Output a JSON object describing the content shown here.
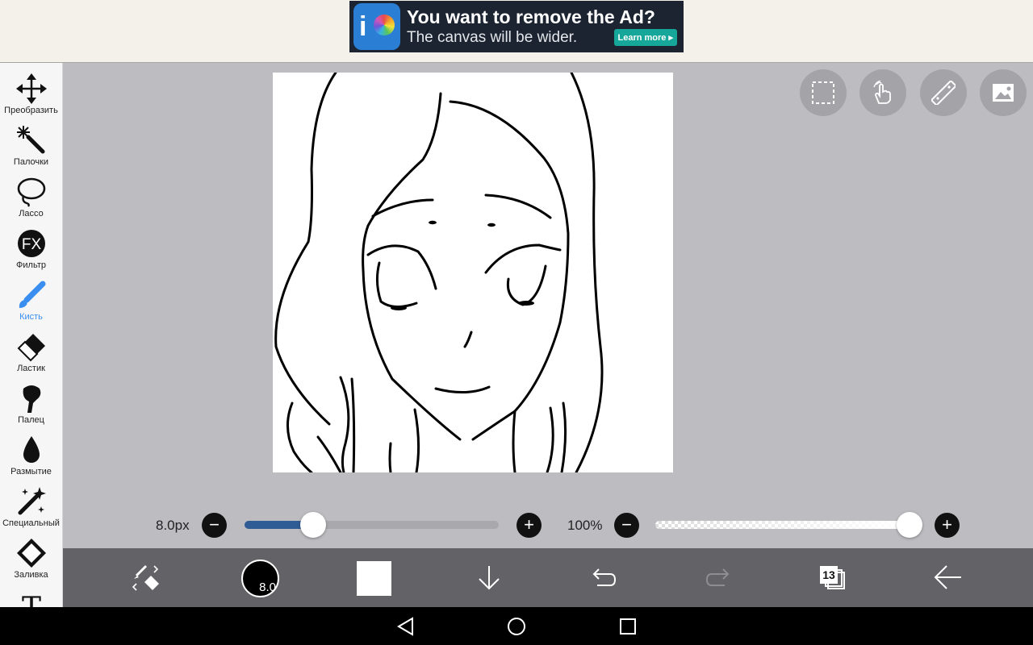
{
  "ad": {
    "headline": "You want to remove the Ad?",
    "subline": "The canvas will be wider.",
    "cta": "Learn more ▸"
  },
  "tools": [
    {
      "label": "Преобразить",
      "icon": "move-icon"
    },
    {
      "label": "Палочки",
      "icon": "magic-wand-icon"
    },
    {
      "label": "Лассо",
      "icon": "lasso-icon"
    },
    {
      "label": "Фильтр",
      "icon": "fx-icon",
      "icon_text": "FX"
    },
    {
      "label": "Кисть",
      "icon": "brush-icon",
      "active": true
    },
    {
      "label": "Ластик",
      "icon": "eraser-icon"
    },
    {
      "label": "Палец",
      "icon": "finger-icon"
    },
    {
      "label": "Размытие",
      "icon": "blur-drop-icon"
    },
    {
      "label": "Специальный",
      "icon": "special-wand-icon"
    },
    {
      "label": "Заливка",
      "icon": "fill-bucket-icon"
    },
    {
      "label": "",
      "icon": "text-tool-icon",
      "icon_text": "T"
    }
  ],
  "top_right_buttons": [
    "selection-icon",
    "hand-icon",
    "ruler-icon",
    "image-import-icon"
  ],
  "brush_size": {
    "label": "8.0px",
    "minus": "−",
    "plus": "+",
    "fraction": 0.27
  },
  "opacity": {
    "label": "100%",
    "minus": "−",
    "plus": "+",
    "fraction": 1.0
  },
  "bottom_bar": {
    "brush_size_badge": "8.0",
    "layers_count": "13",
    "primary_color": "#ffffff",
    "brush_color": "#000000"
  },
  "colors": {
    "accent": "#3a8ef0",
    "slider_fill": "#2f5c95",
    "toolbar_bg": "#636266"
  }
}
